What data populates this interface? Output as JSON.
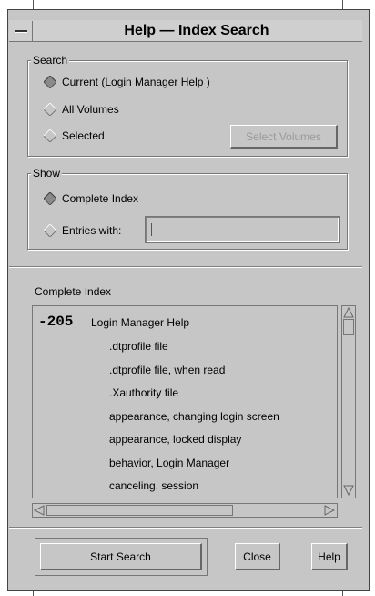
{
  "window": {
    "title": "Help — Index Search"
  },
  "search": {
    "label": "Search",
    "options": [
      {
        "label": "Current (Login Manager Help )",
        "selected": true
      },
      {
        "label": "All Volumes",
        "selected": false
      },
      {
        "label": "Selected",
        "selected": false
      }
    ],
    "select_volumes_label": "Select Volumes"
  },
  "show": {
    "label": "Show",
    "options": [
      {
        "label": "Complete Index",
        "selected": true
      },
      {
        "label": "Entries with:",
        "selected": false
      }
    ],
    "entries_value": ""
  },
  "index": {
    "label": "Complete Index",
    "count": "-205",
    "volume": "Login Manager Help",
    "entries": [
      ".dtprofile file",
      ".dtprofile file, when read",
      ".Xauthority file",
      "appearance, changing login screen",
      "appearance, locked display",
      "behavior, Login Manager",
      "canceling, session"
    ]
  },
  "buttons": {
    "start_search": "Start Search",
    "close": "Close",
    "help": "Help"
  },
  "colors": {
    "background": "#c6c6c6",
    "selected_radio": "#8a8a8a",
    "border": "#777777"
  }
}
